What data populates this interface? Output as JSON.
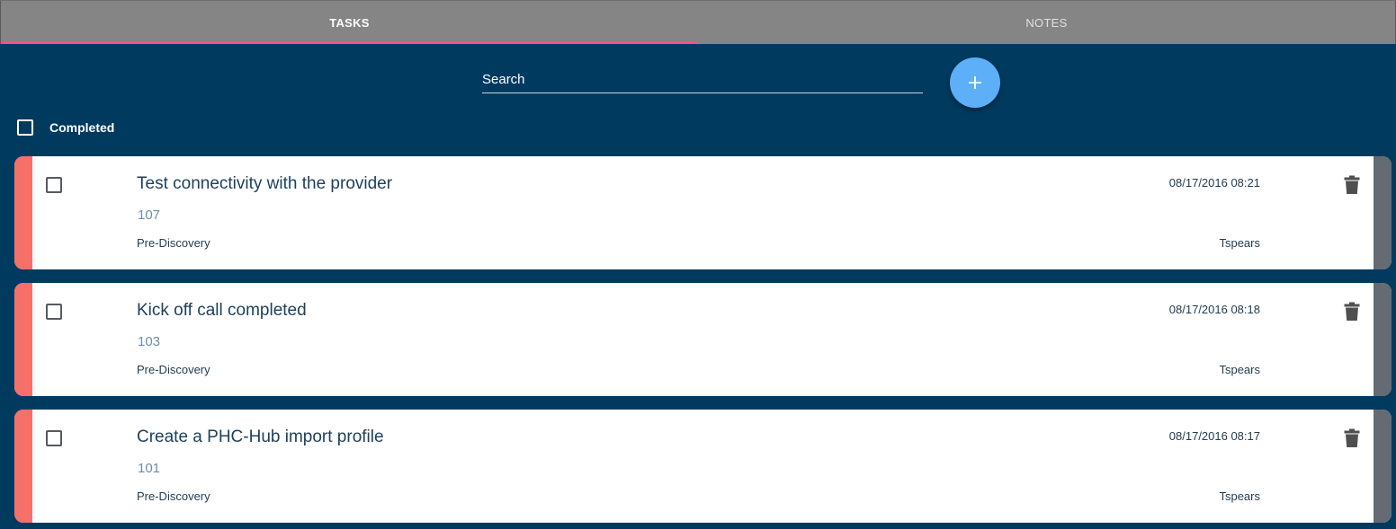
{
  "tabs": [
    {
      "label": "TASKS",
      "active": true
    },
    {
      "label": "NOTES",
      "active": false
    }
  ],
  "search": {
    "placeholder": "Search",
    "value": ""
  },
  "add_button": {
    "icon": "plus-icon"
  },
  "filter": {
    "label": "Completed",
    "checked": false
  },
  "colors": {
    "background": "#013a5f",
    "tab_bar": "#858585",
    "tab_indicator": "#ff4f8b",
    "fab": "#5db0f7",
    "task_stripe": "#f6706a",
    "task_right_bar": "#646b73"
  },
  "tasks": [
    {
      "title": "Test connectivity with the provider",
      "number": "107",
      "phase": "Pre-Discovery",
      "date": "08/17/2016 08:21",
      "owner": "Tspears",
      "checked": false
    },
    {
      "title": "Kick off call completed",
      "number": "103",
      "phase": "Pre-Discovery",
      "date": "08/17/2016 08:18",
      "owner": "Tspears",
      "checked": false
    },
    {
      "title": "Create a PHC-Hub import profile",
      "number": "101",
      "phase": "Pre-Discovery",
      "date": "08/17/2016 08:17",
      "owner": "Tspears",
      "checked": false
    }
  ]
}
